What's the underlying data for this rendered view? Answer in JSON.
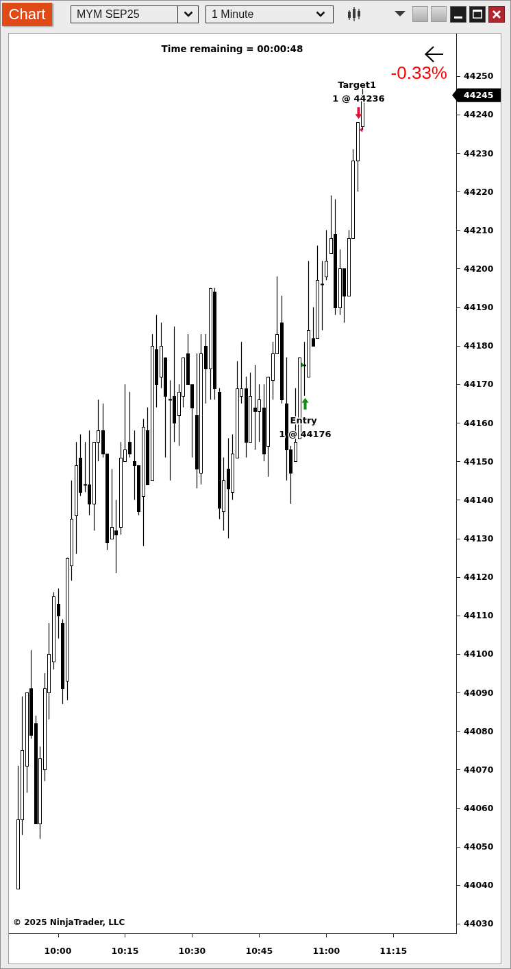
{
  "toolbar": {
    "title": "Chart",
    "instrument": "MYM SEP25",
    "interval": "1 Minute"
  },
  "chart": {
    "time_remaining": "Time remaining = 00:00:48",
    "change": "-0.33%",
    "current_price": "44245",
    "copyright": "© 2025 NinjaTrader, LLC",
    "chart_data": {
      "type": "candlestick",
      "x": [
        591,
        592,
        593,
        594,
        595,
        596,
        597,
        598,
        599,
        600,
        601,
        602,
        603,
        604,
        605,
        606,
        607,
        608,
        609,
        610,
        611,
        612,
        613,
        614,
        615,
        616,
        617,
        618,
        619,
        620,
        621,
        622,
        623,
        624,
        625,
        626,
        627,
        628,
        629,
        630,
        631,
        632,
        633,
        634,
        635,
        636,
        637,
        638,
        639,
        640,
        641,
        642,
        643,
        644,
        645,
        646,
        647,
        648,
        649,
        650,
        651,
        652,
        653,
        654,
        655,
        656,
        657,
        658,
        659,
        660,
        661,
        662,
        663,
        664,
        665,
        666,
        667,
        668
      ],
      "ohlc": [
        [
          44039,
          44071,
          44039,
          44057
        ],
        [
          44057,
          44089,
          44053,
          44075
        ],
        [
          44071,
          44090,
          44064,
          44090
        ],
        [
          44091,
          44101,
          44078,
          44079
        ],
        [
          44082,
          44084,
          44056,
          44056
        ],
        [
          44056,
          44076,
          44052,
          44073
        ],
        [
          44070,
          44095,
          44067,
          44091
        ],
        [
          44090,
          44108,
          44083,
          44100
        ],
        [
          44098,
          44116,
          44096,
          44115
        ],
        [
          44113,
          44117,
          44104,
          44110
        ],
        [
          44108,
          44109,
          44087,
          44091
        ],
        [
          44093,
          44125,
          44088,
          44125
        ],
        [
          44123,
          44145,
          44119,
          44135
        ],
        [
          44136,
          44155,
          44126,
          44149
        ],
        [
          44151,
          44157,
          44141,
          44142
        ],
        [
          44144,
          44155,
          44142,
          44144
        ],
        [
          44144,
          44158,
          44136,
          44139
        ],
        [
          44139,
          44155,
          44132,
          44155
        ],
        [
          44155,
          44166,
          44150,
          44158
        ],
        [
          44158,
          44165,
          44151,
          44152
        ],
        [
          44152,
          44152,
          44127,
          44129
        ],
        [
          44130,
          44148,
          44130,
          44133
        ],
        [
          44132,
          44140,
          44121,
          44131
        ],
        [
          44133,
          44155,
          44131,
          44151
        ],
        [
          44150,
          44170,
          44150,
          44153
        ],
        [
          44155,
          44168,
          44151,
          44152
        ],
        [
          44150,
          44158,
          44140,
          44149
        ],
        [
          44149,
          44149,
          44136,
          44137
        ],
        [
          44141,
          44161,
          44128,
          44159
        ],
        [
          44158,
          44164,
          44144,
          44144
        ],
        [
          44145,
          44183,
          44145,
          44180
        ],
        [
          44179,
          44188,
          44164,
          44170
        ],
        [
          44172,
          44186,
          44169,
          44180
        ],
        [
          44177,
          44177,
          44151,
          44167
        ],
        [
          44166,
          44171,
          44145,
          44166
        ],
        [
          44167,
          44185,
          44155,
          44160
        ],
        [
          44162,
          44170,
          44154,
          44168
        ],
        [
          44167,
          44177,
          44164,
          44177
        ],
        [
          44178,
          44183,
          44170,
          44170
        ],
        [
          44170,
          44170,
          44151,
          44164
        ],
        [
          44162,
          44178,
          44143,
          44148
        ],
        [
          44147,
          44183,
          44144,
          44178
        ],
        [
          44180,
          44183,
          44165,
          44174
        ],
        [
          44174,
          44195,
          44166,
          44195
        ],
        [
          44194,
          44195,
          44166,
          44169
        ],
        [
          44168,
          44169,
          44135,
          44138
        ],
        [
          44137,
          44151,
          44132,
          44145
        ],
        [
          44148,
          44156,
          44130,
          44143
        ],
        [
          44142,
          44157,
          44140,
          44152
        ],
        [
          44151,
          44176,
          44151,
          44169
        ],
        [
          44167,
          44181,
          44165,
          44169
        ],
        [
          44169,
          44172,
          44151,
          44155
        ],
        [
          44155,
          44173,
          44155,
          44167
        ],
        [
          44164,
          44175,
          44153,
          44163
        ],
        [
          44163,
          44170,
          44155,
          44166
        ],
        [
          44164,
          44170,
          44150,
          44152
        ],
        [
          44154,
          44172,
          44146,
          44172
        ],
        [
          44171,
          44181,
          44166,
          44178
        ],
        [
          44178,
          44198,
          44178,
          44183
        ],
        [
          44186,
          44193,
          44165,
          44166
        ],
        [
          44165,
          44177,
          44145,
          44153
        ],
        [
          44153,
          44154,
          44139,
          44147
        ],
        [
          44150,
          44169,
          44150,
          44155
        ],
        [
          44156,
          44177,
          44156,
          44177
        ],
        [
          44175,
          44181,
          44167,
          44175
        ],
        [
          44172,
          44202,
          44172,
          44184
        ],
        [
          44182,
          44190,
          44180,
          44180
        ],
        [
          44182,
          44206,
          44182,
          44197
        ],
        [
          44196,
          44202,
          44184,
          44196
        ],
        [
          44198,
          44210,
          44197,
          44202
        ],
        [
          44204,
          44219,
          44204,
          44208
        ],
        [
          44209,
          44218,
          44188,
          44190
        ],
        [
          44190,
          44205,
          44188,
          44200
        ],
        [
          44200,
          44200,
          44186,
          44193
        ],
        [
          44193,
          44210,
          44193,
          44208
        ],
        [
          44208,
          44231,
          44208,
          44228
        ],
        [
          44228,
          44238,
          44220,
          44238
        ],
        [
          44237,
          44247,
          44236,
          44245
        ]
      ],
      "xlim": [
        589.05,
        689.05
      ],
      "ylim": [
        44027.5,
        44261.0
      ],
      "xticks": [
        {
          "value": 600,
          "label": "10:00"
        },
        {
          "value": 615,
          "label": "10:15"
        },
        {
          "value": 630,
          "label": "10:30"
        },
        {
          "value": 645,
          "label": "10:45"
        },
        {
          "value": 660,
          "label": "11:00"
        },
        {
          "value": 675,
          "label": "11:15"
        }
      ],
      "yticks": [
        44030,
        44040,
        44050,
        44060,
        44070,
        44080,
        44090,
        44100,
        44110,
        44120,
        44130,
        44140,
        44150,
        44160,
        44170,
        44180,
        44190,
        44200,
        44210,
        44220,
        44230,
        44240,
        44250
      ],
      "annotations": [
        {
          "text": "Entry\n1 @ 44176",
          "x": 655,
          "y": 44167
        },
        {
          "text": "Target1\n1 @ 44236",
          "x": 667,
          "y": 44238
        }
      ]
    }
  }
}
